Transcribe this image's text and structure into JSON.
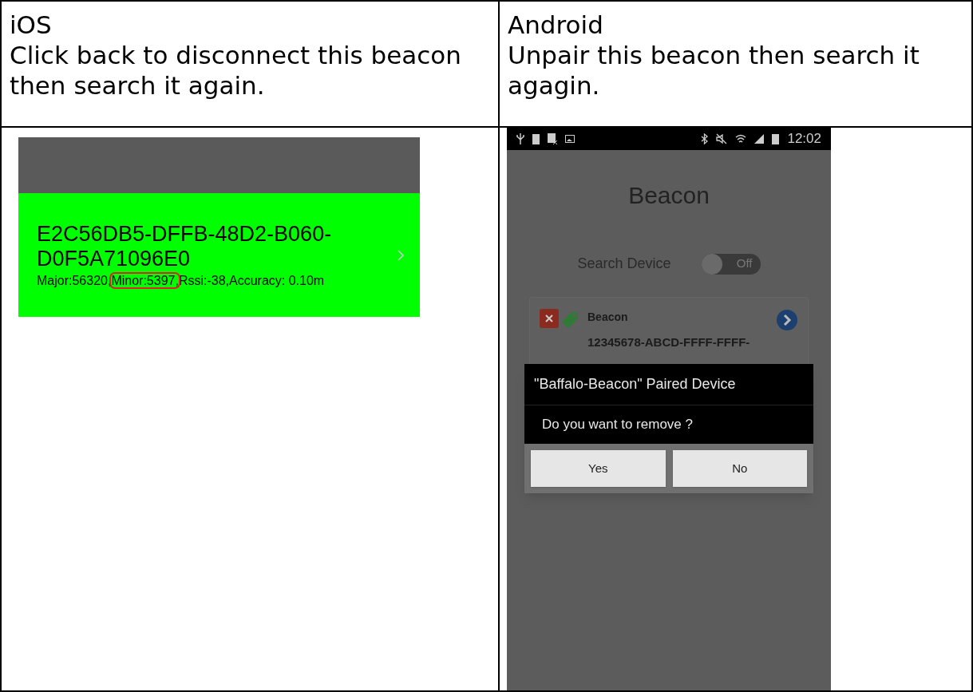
{
  "columns": [
    {
      "kind": "ios",
      "title": "iOS",
      "instruction": "Click back to disconnect this beacon then search it again.",
      "screen": {
        "uuid": "E2C56DB5-DFFB-48D2-B060-D0F5A71096E0",
        "details": [
          {
            "text": "Major:56320,",
            "highlighted": false
          },
          {
            "text": "Minor:5397,",
            "highlighted": true
          },
          {
            "text": "Rssi:-38,Accuracy: 0.10m",
            "highlighted": false
          }
        ]
      }
    },
    {
      "kind": "android",
      "title": "Android",
      "instruction": "Unpair this beacon then search it agagin.",
      "screen": {
        "time": "12:02",
        "app_title": "Beacon",
        "search_label": "Search Device",
        "search_toggle": {
          "on": false,
          "label": "Off"
        },
        "device": {
          "name": "Beacon",
          "uuid": "12345678-ABCD-FFFF-FFFF-"
        },
        "dialog": {
          "title": "\"Baffalo-Beacon\" Paired Device",
          "message": "Do you want to remove ?",
          "buttons": [
            "Yes",
            "No"
          ]
        }
      }
    }
  ]
}
